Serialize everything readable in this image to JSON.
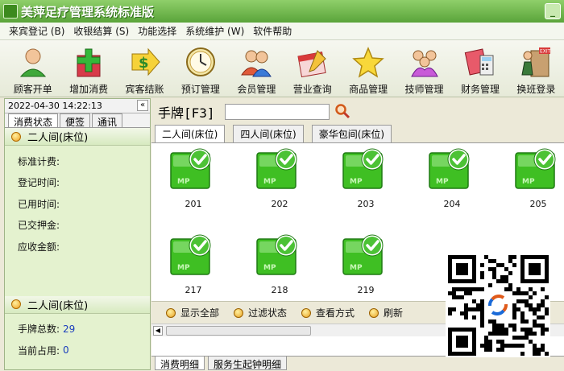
{
  "window": {
    "title": "美萍足疗管理系统标准版",
    "min_label": "_"
  },
  "menu": [
    "来宾登记 (B)",
    "收银结算 (S)",
    "功能选择",
    "系统维护 (W)",
    "软件帮助"
  ],
  "toolbar": [
    {
      "label": "顾客开单",
      "icon": "customer-icon"
    },
    {
      "label": "增加消费",
      "icon": "add-consumption-icon"
    },
    {
      "label": "宾客结账",
      "icon": "checkout-icon"
    },
    {
      "label": "预订管理",
      "icon": "clock-icon"
    },
    {
      "label": "会员管理",
      "icon": "members-icon"
    },
    {
      "label": "营业查询",
      "icon": "calendar-icon"
    },
    {
      "label": "商品管理",
      "icon": "star-icon"
    },
    {
      "label": "技师管理",
      "icon": "technician-icon"
    },
    {
      "label": "财务管理",
      "icon": "finance-icon"
    },
    {
      "label": "换班登录",
      "icon": "exit-icon"
    }
  ],
  "left": {
    "datetime": "2022-04-30 14:22:13",
    "collapse": "«",
    "tabs": [
      "消费状态",
      "便签",
      "通讯"
    ],
    "section1_title": "二人间(床位)",
    "fields": [
      "标准计费:",
      "登记时间:",
      "已用时间:",
      "已交押金:",
      "应收金额:"
    ],
    "section2_title": "二人间(床位)",
    "total_label": "手牌总数:",
    "total_value": "29",
    "occupied_label": "当前占用:",
    "occupied_value": "0"
  },
  "main": {
    "search_label": "手牌[F3]",
    "search_value": "",
    "tabs": [
      "二人间(床位)",
      "四人间(床位)",
      "豪华包间(床位)"
    ],
    "rooms": [
      "201",
      "202",
      "203",
      "204",
      "205",
      "217",
      "218",
      "219"
    ],
    "bottom_buttons": [
      "显示全部",
      "过滤状态",
      "查看方式",
      "刷新"
    ],
    "detail_tabs": [
      "消费明细",
      "服务生起钟明细"
    ]
  },
  "colors": {
    "accent": "#5aa43a",
    "room": "#3fbf23",
    "value": "#1a3dbd"
  }
}
